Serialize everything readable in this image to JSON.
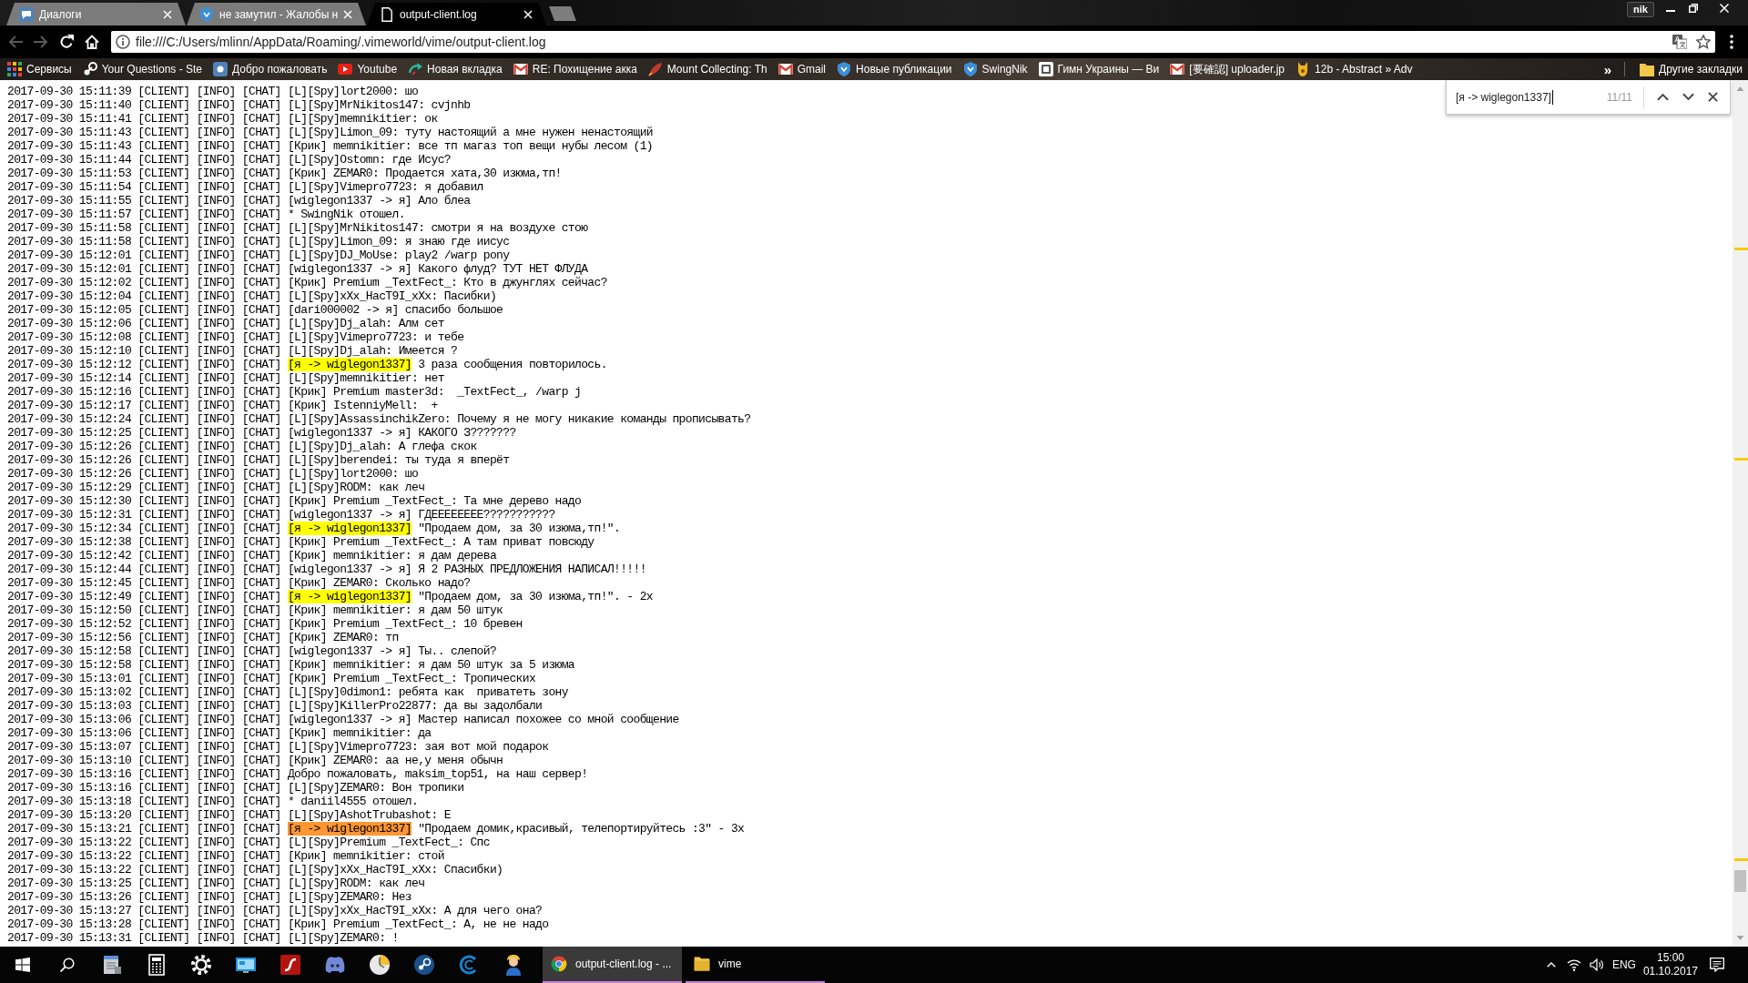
{
  "browser": {
    "tabs": [
      {
        "title": "Диалоги",
        "kind": "vk",
        "selected": false
      },
      {
        "title": "не замутил - Жалобы н",
        "kind": "vime",
        "selected": false
      },
      {
        "title": "output-client.log",
        "kind": "file",
        "selected": true
      }
    ],
    "profile": "nik",
    "back": {
      "disabled": true
    },
    "forward": {
      "disabled": true
    },
    "address": "file:///C:/Users/mlinn/AppData/Roaming/.vimeworld/vime/output-client.log",
    "bookmarks": [
      {
        "label": "Сервисы",
        "kind": "apps"
      },
      {
        "label": "Your Questions - Ste",
        "kind": "steam"
      },
      {
        "label": "Добро пожаловать",
        "kind": "vk"
      },
      {
        "label": "Youtube",
        "kind": "youtube"
      },
      {
        "label": "Новая вкладка",
        "kind": "hook"
      },
      {
        "label": "RE: Похищение акка",
        "kind": "mail"
      },
      {
        "label": "Mount Collecting: Th",
        "kind": "mount"
      },
      {
        "label": "Gmail",
        "kind": "mail"
      },
      {
        "label": "Новые публикации",
        "kind": "vime"
      },
      {
        "label": "SwingNik",
        "kind": "vime"
      },
      {
        "label": "Гимн Украины — Ви",
        "kind": "wiki"
      },
      {
        "label": "[要確認] uploader.jp",
        "kind": "mail"
      },
      {
        "label": "12b - Abstract » Adv",
        "kind": "critter"
      }
    ],
    "bookmarks_more": "»",
    "other_bookmarks": "Другие закладки"
  },
  "find_bar": {
    "query": "[я -> wiglegon1337]",
    "count": "11/11"
  },
  "log": {
    "lines": [
      {
        "text": "2017-09-30 15:11:39 [CLIENT] [INFO] [CHAT] [L][Spy]lort2000: шо"
      },
      {
        "text": "2017-09-30 15:11:40 [CLIENT] [INFO] [CHAT] [L][Spy]MrNikitos147: cvjnhb"
      },
      {
        "text": "2017-09-30 15:11:41 [CLIENT] [INFO] [CHAT] [L][Spy]memnikitier: ок"
      },
      {
        "text": "2017-09-30 15:11:43 [CLIENT] [INFO] [CHAT] [L][Spy]Limon_09: туту настоящий а мне нужен ненастоящий"
      },
      {
        "text": "2017-09-30 15:11:43 [CLIENT] [INFO] [CHAT] [Крик] memnikitier: все тп магаз топ вещи нубы лесом (1)"
      },
      {
        "text": "2017-09-30 15:11:44 [CLIENT] [INFO] [CHAT] [L][Spy]Ostomn: где Исус?"
      },
      {
        "text": "2017-09-30 15:11:53 [CLIENT] [INFO] [CHAT] [Крик] ZEMAR0: Продается хата,30 изюма,тп!"
      },
      {
        "text": "2017-09-30 15:11:54 [CLIENT] [INFO] [CHAT] [L][Spy]Vimepro7723: я добавил"
      },
      {
        "text": "2017-09-30 15:11:55 [CLIENT] [INFO] [CHAT] [wiglegon1337 -> я] Ало блеа"
      },
      {
        "text": "2017-09-30 15:11:57 [CLIENT] [INFO] [CHAT] * SwingNik отошел."
      },
      {
        "text": "2017-09-30 15:11:58 [CLIENT] [INFO] [CHAT] [L][Spy]MrNikitos147: смотри я на воздухе стою"
      },
      {
        "text": "2017-09-30 15:11:58 [CLIENT] [INFO] [CHAT] [L][Spy]Limon_09: я знаю где иисус"
      },
      {
        "text": "2017-09-30 15:12:01 [CLIENT] [INFO] [CHAT] [L][Spy]DJ_MoUse: play2 /warp pony"
      },
      {
        "text": "2017-09-30 15:12:01 [CLIENT] [INFO] [CHAT] [wiglegon1337 -> я] Какого флуд? ТУТ НЕТ ФЛУДА"
      },
      {
        "text": "2017-09-30 15:12:02 [CLIENT] [INFO] [CHAT] [Крик] Premium _TextFect_: Кто в джунглях сейчас?"
      },
      {
        "text": "2017-09-30 15:12:04 [CLIENT] [INFO] [CHAT] [L][Spy]xXx_HacT9I_xXx: Пасибки)"
      },
      {
        "text": "2017-09-30 15:12:05 [CLIENT] [INFO] [CHAT] [dari000002 -> я] спасибо большое"
      },
      {
        "text": "2017-09-30 15:12:06 [CLIENT] [INFO] [CHAT] [L][Spy]Dj_alah: Алм сет"
      },
      {
        "text": "2017-09-30 15:12:08 [CLIENT] [INFO] [CHAT] [L][Spy]Vimepro7723: и тебе"
      },
      {
        "text": "2017-09-30 15:12:10 [CLIENT] [INFO] [CHAT] [L][Spy]Dj_alah: Имеется ?"
      },
      {
        "text": "2017-09-30 15:12:12 [CLIENT] [INFO] [CHAT]",
        "hit": {
          "text": "[я -> wiglegon1337]",
          "current": false
        },
        "after": "3 раза сообщения повторилось."
      },
      {
        "text": "2017-09-30 15:12:14 [CLIENT] [INFO] [CHAT] [L][Spy]memnikitier: нет"
      },
      {
        "text": "2017-09-30 15:12:16 [CLIENT] [INFO] [CHAT] [Крик] Premium master3d:  _TextFect_, /warp j"
      },
      {
        "text": "2017-09-30 15:12:17 [CLIENT] [INFO] [CHAT] [Крик] IstenniyMell:  +"
      },
      {
        "text": "2017-09-30 15:12:24 [CLIENT] [INFO] [CHAT] [L][Spy]AssassinchikZero: Почему я не могу никакие команды прописывать?"
      },
      {
        "text": "2017-09-30 15:12:25 [CLIENT] [INFO] [CHAT] [wiglegon1337 -> я] КАКОГО З???????"
      },
      {
        "text": "2017-09-30 15:12:26 [CLIENT] [INFO] [CHAT] [L][Spy]Dj_alah: А глефа скок"
      },
      {
        "text": "2017-09-30 15:12:26 [CLIENT] [INFO] [CHAT] [L][Spy]berendei: ты туда я вперёт"
      },
      {
        "text": "2017-09-30 15:12:26 [CLIENT] [INFO] [CHAT] [L][Spy]lort2000: шо"
      },
      {
        "text": "2017-09-30 15:12:29 [CLIENT] [INFO] [CHAT] [L][Spy]RODM: как леч"
      },
      {
        "text": "2017-09-30 15:12:30 [CLIENT] [INFO] [CHAT] [Крик] Premium _TextFect_: Та мне дерево надо"
      },
      {
        "text": "2017-09-30 15:12:31 [CLIENT] [INFO] [CHAT] [wiglegon1337 -> я] ГДЕЕЕЕЕЕЕЕ???????????"
      },
      {
        "text": "2017-09-30 15:12:34 [CLIENT] [INFO] [CHAT]",
        "hit": {
          "text": "[я -> wiglegon1337]",
          "current": false
        },
        "after": "\"Продаем дом, за 30 изюма,тп!\"."
      },
      {
        "text": "2017-09-30 15:12:38 [CLIENT] [INFO] [CHAT] [Крик] Premium _TextFect_: А там приват повсюду"
      },
      {
        "text": "2017-09-30 15:12:42 [CLIENT] [INFO] [CHAT] [Крик] memnikitier: я дам дерева"
      },
      {
        "text": "2017-09-30 15:12:44 [CLIENT] [INFO] [CHAT] [wiglegon1337 -> я] Я 2 РАЗНЫХ ПРЕДЛОЖЕНИЯ НАПИСАЛ!!!!!"
      },
      {
        "text": "2017-09-30 15:12:45 [CLIENT] [INFO] [CHAT] [Крик] ZEMAR0: Сколько надо?"
      },
      {
        "text": "2017-09-30 15:12:49 [CLIENT] [INFO] [CHAT]",
        "hit": {
          "text": "[я -> wiglegon1337]",
          "current": false
        },
        "after": "\"Продаем дом, за 30 изюма,тп!\". - 2x"
      },
      {
        "text": "2017-09-30 15:12:50 [CLIENT] [INFO] [CHAT] [Крик] memnikitier: я дам 50 штук"
      },
      {
        "text": "2017-09-30 15:12:52 [CLIENT] [INFO] [CHAT] [Крик] Premium _TextFect_: 10 бревен"
      },
      {
        "text": "2017-09-30 15:12:56 [CLIENT] [INFO] [CHAT] [Крик] ZEMAR0: тп"
      },
      {
        "text": "2017-09-30 15:12:58 [CLIENT] [INFO] [CHAT] [wiglegon1337 -> я] Ты.. слепой?"
      },
      {
        "text": "2017-09-30 15:12:58 [CLIENT] [INFO] [CHAT] [Крик] memnikitier: я дам 50 штук за 5 изюма"
      },
      {
        "text": "2017-09-30 15:13:01 [CLIENT] [INFO] [CHAT] [Крик] Premium _TextFect_: Тропических"
      },
      {
        "text": "2017-09-30 15:13:02 [CLIENT] [INFO] [CHAT] [L][Spy]0dimon1: ребята как  приватеть зону"
      },
      {
        "text": "2017-09-30 15:13:03 [CLIENT] [INFO] [CHAT] [L][Spy]KillerPro22877: да вы задолбали"
      },
      {
        "text": "2017-09-30 15:13:06 [CLIENT] [INFO] [CHAT] [wiglegon1337 -> я] Мастер написал похожее со мной сообщение"
      },
      {
        "text": "2017-09-30 15:13:06 [CLIENT] [INFO] [CHAT] [Крик] memnikitier: да"
      },
      {
        "text": "2017-09-30 15:13:07 [CLIENT] [INFO] [CHAT] [L][Spy]Vimepro7723: зая вот мой подарок"
      },
      {
        "text": "2017-09-30 15:13:10 [CLIENT] [INFO] [CHAT] [Крик] ZEMAR0: аа не,у меня обычн"
      },
      {
        "text": "2017-09-30 15:13:16 [CLIENT] [INFO] [CHAT] Добро пожаловать, maksim_top51, на наш сервер!"
      },
      {
        "text": "2017-09-30 15:13:16 [CLIENT] [INFO] [CHAT] [L][Spy]ZEMAR0: Вон тропики"
      },
      {
        "text": "2017-09-30 15:13:18 [CLIENT] [INFO] [CHAT] * daniil4555 отошел."
      },
      {
        "text": "2017-09-30 15:13:20 [CLIENT] [INFO] [CHAT] [L][Spy]AshotTrubashot: Е"
      },
      {
        "text": "2017-09-30 15:13:21 [CLIENT] [INFO] [CHAT]",
        "hit": {
          "text": "[я -> wiglegon1337]",
          "current": true
        },
        "after": "\"Продаем домик,красивый, телепортируйтесь :3\" - 3x"
      },
      {
        "text": "2017-09-30 15:13:22 [CLIENT] [INFO] [CHAT] [L][Spy]Premium _TextFect_: Спс"
      },
      {
        "text": "2017-09-30 15:13:22 [CLIENT] [INFO] [CHAT] [Крик] memnikitier: стой"
      },
      {
        "text": "2017-09-30 15:13:22 [CLIENT] [INFO] [CHAT] [L][Spy]xXx_HacT9I_xXx: Спасибки)"
      },
      {
        "text": "2017-09-30 15:13:25 [CLIENT] [INFO] [CHAT] [L][Spy]RODM: как леч"
      },
      {
        "text": "2017-09-30 15:13:26 [CLIENT] [INFO] [CHAT] [L][Spy]ZEMAR0: Нез"
      },
      {
        "text": "2017-09-30 15:13:27 [CLIENT] [INFO] [CHAT] [L][Spy]xXx_HacT9I_xXx: А для чего она?"
      },
      {
        "text": "2017-09-30 15:13:28 [CLIENT] [INFO] [CHAT] [Крик] Premium _TextFect_: А, не не надо"
      },
      {
        "text": "2017-09-30 15:13:31 [CLIENT] [INFO] [CHAT] [L][Spy]ZEMAR0: !"
      }
    ]
  },
  "taskbar": {
    "windows": [
      {
        "label": "output-client.log - ...",
        "kind": "browser",
        "selected": true
      },
      {
        "label": "vime",
        "kind": "folder",
        "selected": false
      }
    ],
    "language": "ENG",
    "time": "15:00",
    "date": "01.10.2017"
  }
}
